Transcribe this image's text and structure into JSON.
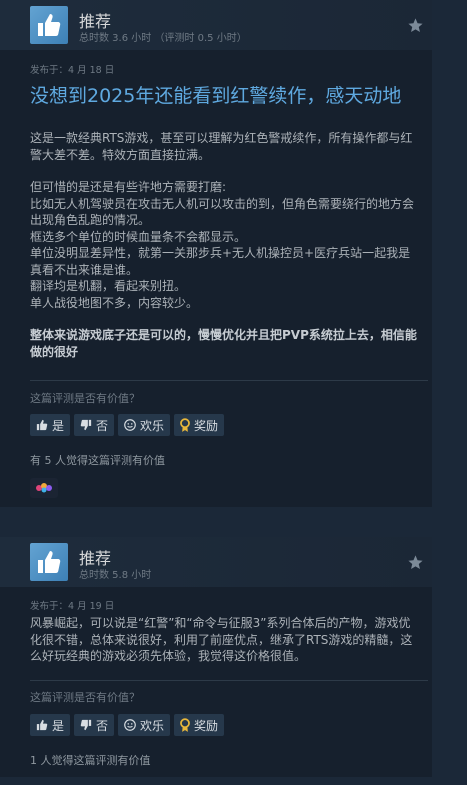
{
  "reviews": [
    {
      "verdict": "推荐",
      "hours": "总时数 3.6 小时 （评测时 0.5 小时）",
      "posted": "发布于：4 月 18 日",
      "headline": "没想到2025年还能看到红警续作，感天动地",
      "paragraphs": [
        "这是一款经典RTS游戏，甚至可以理解为红色警戒续作，所有操作都与红警大差不差。特效方面直接拉满。",
        "",
        "但可惜的是还是有些许地方需要打磨:",
        "比如无人机驾驶员在攻击无人机可以攻击的到，但角色需要绕行的地方会出现角色乱跑的情况。",
        "框选多个单位的时候血量条不会都显示。",
        "单位没明显差异性，就第一关那步兵+无人机操控员+医疗兵站一起我是真看不出来谁是谁。",
        "翻译均是机翻，看起来别扭。",
        "单人战役地图不多，内容较少。",
        ""
      ],
      "bold_text": "整体来说游戏底子还是可以的，慢慢优化并且把PVP系统拉上去，相信能做的很好",
      "question": "这篇评测是否有价值？",
      "helpful": "有 5 人觉得这篇评测有价值"
    },
    {
      "verdict": "推荐",
      "hours": "总时数 5.8 小时",
      "posted": "发布于：4 月 19 日",
      "paragraphs": [
        "风暴崛起，可以说是“红警”和“命令与征服3”系列合体后的产物，游戏优化很不错，总体来说很好，利用了前座优点，继承了RTS游戏的精髓，这么好玩经典的游戏必须先体验，我觉得这价格很值。"
      ],
      "question": "这篇评测是否有价值？",
      "helpful": "1 人觉得这篇评测有价值"
    }
  ],
  "buttons": {
    "yes": "是",
    "no": "否",
    "funny": "欢乐",
    "award": "奖励"
  },
  "icons": {
    "recommend": "thumbs-up-icon",
    "star": "star-icon",
    "yes": "thumbs-up-icon",
    "no": "thumbs-down-icon",
    "funny": "smiley-icon",
    "award": "award-icon"
  },
  "colors": {
    "background": "#1b2838",
    "card": "#16202d",
    "headline": "#5fa9e0",
    "button": "#26384b",
    "award_gold": "#e8b73a"
  }
}
